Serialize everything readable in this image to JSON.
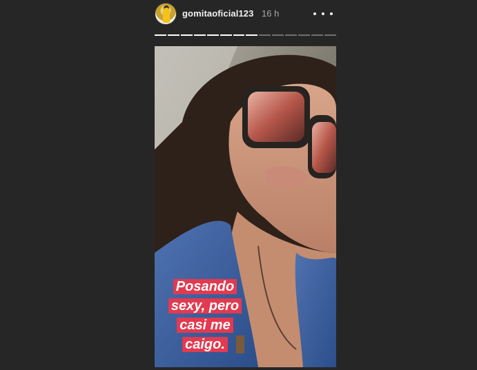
{
  "story": {
    "username": "gomitaoficial123",
    "time_ago": "16 h",
    "more_icon": "more-options-icon",
    "progress": {
      "total_segments": 14,
      "completed_segments": 8
    },
    "caption_lines": [
      "Posando",
      "sexy, pero",
      "casi me",
      "caigo."
    ]
  },
  "colors": {
    "background": "#262626",
    "caption_bg": "#e23a50",
    "text": "#f2f2f2",
    "muted_text": "#a8a8a8"
  }
}
